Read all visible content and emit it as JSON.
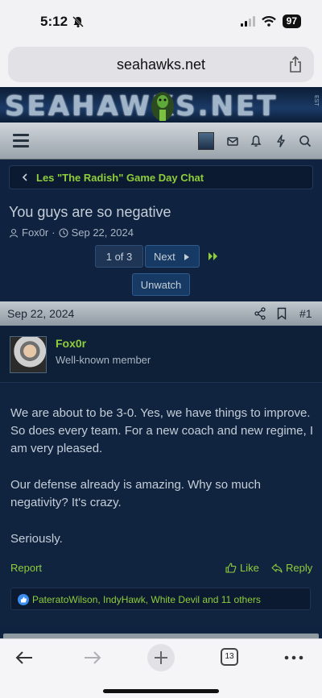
{
  "status_bar": {
    "time": "5:12",
    "battery": "97"
  },
  "browser": {
    "url": "seahawks.net",
    "tab_count": "13"
  },
  "site": {
    "banner_text": "SEAHAWKS.NET",
    "est_label": "EST"
  },
  "breadcrumb": {
    "label": "Les \"The Radish\" Game Day Chat"
  },
  "thread": {
    "title": "You guys are so negative",
    "author": "Fox0r",
    "date": "Sep 22, 2024",
    "separator": "·"
  },
  "pagination": {
    "current": "1 of 3",
    "next_label": "Next"
  },
  "watch_button": {
    "label": "Unwatch"
  },
  "post": {
    "date": "Sep 22, 2024",
    "number": "#1",
    "username": "Fox0r",
    "user_title": "Well-known member",
    "paragraphs": [
      "We are about to be 3-0. Yes, we have things to improve. So does every team. For a new coach and new regime, I am very pleased.",
      "Our defense already is amazing. Why so much negativity? It's crazy.",
      "Seriously."
    ],
    "report_label": "Report",
    "like_label": "Like",
    "reply_label": "Reply",
    "reactions_text": "PateratoWilson, IndyHawk, White Devil and 11 others"
  },
  "colors": {
    "accent_green": "#8fce3a",
    "page_bg": "#0f2240",
    "header_silver": "#aab3bb"
  }
}
